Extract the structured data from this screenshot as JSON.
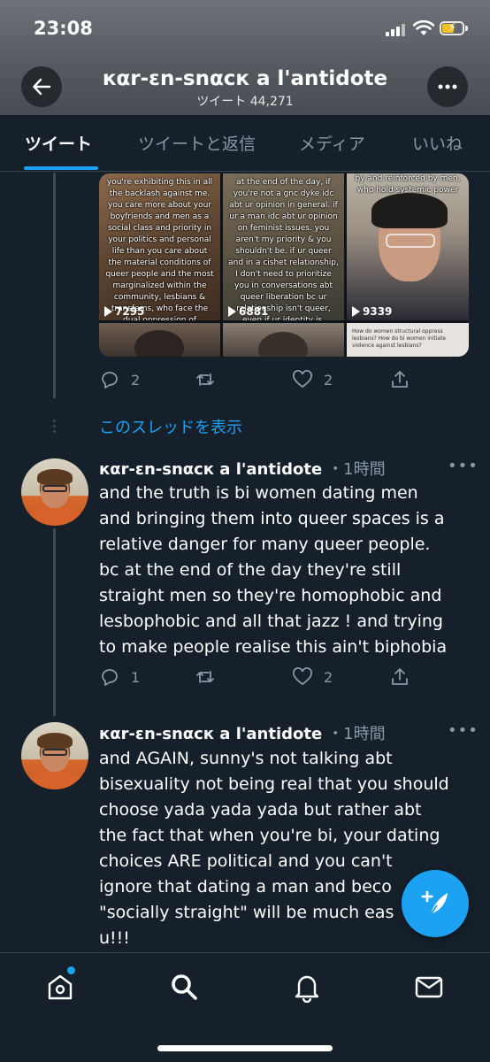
{
  "status_bar": {
    "time": "23:08"
  },
  "header": {
    "title": "кαr-ɛn-ѕnαcк a l'antidote",
    "subtitle": "ツイート 44,271"
  },
  "tabs": [
    {
      "label": "ツイート",
      "active": true
    },
    {
      "label": "ツイートと返信",
      "active": false
    },
    {
      "label": "メディア",
      "active": false
    },
    {
      "label": "いいね",
      "active": false
    }
  ],
  "media": {
    "videos": [
      {
        "caption": "you're exhibiting this in all the backlash against me. you care more about your boyfriends and men as a social class and priority in your politics and personal life than you care about the material conditions of queer people and the most marginalized within the community, lesbians & transfems, who face the dual oppression of homophobia & misogyny to the point that none of the rest of you face!",
        "views": "7295"
      },
      {
        "caption": "at the end of the day, if you're not a gnc dyke idc abt ur opinion in general. if ur a man idc abt ur opinion on feminist issues. you aren't my priority & you shouldn't be. if ur queer and in a cishet relationship, I don't need to prioritize you in conversations abt queer liberation bc ur relationship isn't queer, even if ur identity is.",
        "views": "6881"
      },
      {
        "caption": "by and reinforced by men, who hold systemic power",
        "views": "9339"
      }
    ],
    "bottom_card_text": "How do women structural oppress lesbians? How do bi women initiate violence against lesbians?"
  },
  "first_tweet_actions": {
    "replies": "2",
    "likes": "2"
  },
  "show_thread": "このスレッドを表示",
  "tweets": [
    {
      "name": "кαr-ɛn-ѕnαcк a l'antidote",
      "time": "・1時間",
      "lines": [
        "and the truth is bi women dating men",
        "and bringing them into queer spaces is a",
        "relative danger for many queer people.",
        "bc at the end of the day they're still",
        "straight men so they're homophobic and",
        "lesbophobic and all that jazz ! and trying",
        "to make people realise this ain't biphobia"
      ],
      "replies": "1",
      "likes": "2"
    },
    {
      "name": "кαr-ɛn-ѕnαcк a l'antidote",
      "time": "・1時間",
      "lines": [
        "and AGAIN, sunny's not talking abt",
        "bisexuality not being real that you should",
        "choose yada yada yada but rather abt",
        "the fact that when you're bi, your dating",
        "choices ARE political and you can't",
        "ignore that dating a man and beco",
        "\"socially straight\" will be much eas",
        "u!!!"
      ]
    }
  ],
  "colors": {
    "accent": "#1da1f2",
    "background": "#15202b",
    "muted": "#8899a6"
  }
}
